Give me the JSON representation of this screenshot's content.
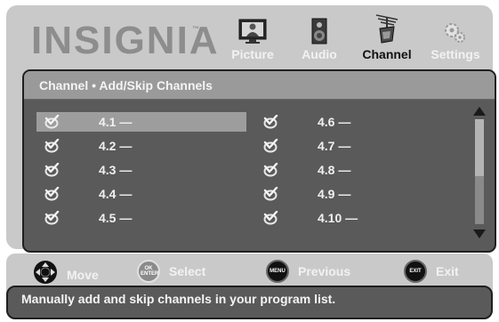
{
  "header": {
    "brand": "INSIGNIA",
    "brand_tm": "™",
    "tabs": [
      {
        "label": "Picture",
        "icon": "picture-icon",
        "active": false
      },
      {
        "label": "Audio",
        "icon": "audio-speaker-icon",
        "active": false
      },
      {
        "label": "Channel",
        "icon": "channel-antenna-icon",
        "active": true
      },
      {
        "label": "Settings",
        "icon": "settings-gears-icon",
        "active": false
      }
    ]
  },
  "panel": {
    "title": "Channel • Add/Skip Channels",
    "channels_left": [
      {
        "number": "4.1 —",
        "checked": true,
        "selected": true
      },
      {
        "number": "4.2 —",
        "checked": true,
        "selected": false
      },
      {
        "number": "4.3 —",
        "checked": true,
        "selected": false
      },
      {
        "number": "4.4 —",
        "checked": true,
        "selected": false
      },
      {
        "number": "4.5 —",
        "checked": true,
        "selected": false
      }
    ],
    "channels_right": [
      {
        "number": "4.6 —",
        "checked": true,
        "selected": false
      },
      {
        "number": "4.7 —",
        "checked": true,
        "selected": false
      },
      {
        "number": "4.8 —",
        "checked": true,
        "selected": false
      },
      {
        "number": "4.9 —",
        "checked": true,
        "selected": false
      },
      {
        "number": "4.10 —",
        "checked": true,
        "selected": false
      }
    ]
  },
  "footer": {
    "hints": [
      {
        "label": "Move",
        "button": ""
      },
      {
        "label": "Select",
        "button": "OK ENTER"
      },
      {
        "label": "Previous",
        "button": "MENU"
      },
      {
        "label": "Exit",
        "button": "EXIT"
      }
    ],
    "help_text": "Manually add and skip channels in your program list."
  },
  "colors": {
    "panel_gray": "#c9c9c9",
    "inner_gray": "#5a5a5a",
    "title_bar": "#9a9a9a",
    "selection": "#9d9d9d"
  }
}
